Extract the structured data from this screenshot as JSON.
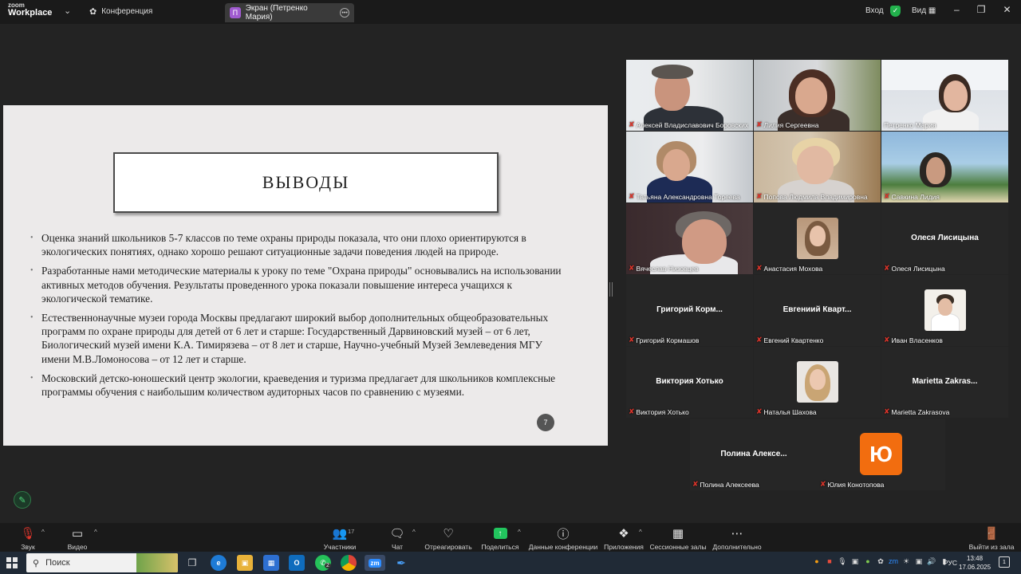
{
  "titlebar": {
    "logo_line1": "zoom",
    "logo_line2": "Workplace",
    "conference_label": "Конференция",
    "screen_tab_badge": "П",
    "screen_tab_label": "Экран (Петренко Мария)",
    "signin_label": "Вход",
    "view_label": "Вид",
    "shield_color": "#22b14c"
  },
  "slide": {
    "title": "ВЫВОДЫ",
    "bullets": [
      "Оценка знаний школьников 5-7 классов по теме охраны природы показала, что они плохо ориентируются в экологических понятиях, однако хорошо решают ситуационные задачи поведения людей на природе.",
      "Разработанные нами методические материалы к уроку по теме \"Охрана природы\" основывались на использовании активных методов обучения. Результаты проведенного урока показали повышение интереса учащихся к экологической тематике.",
      "Естественнонаучные музеи города Москвы предлагают широкий выбор дополнительных общеобразовательных программ по охране природы для детей от 6 лет и старше: Государственный Дарвиновский музей – от 6 лет, Биологический музей имени К.А. Тимирязева – от 8 лет и старше, Научно-учебный Музей Землеведения МГУ имени М.В.Ломоносова – от 12 лет и старше.",
      "Московский детско-юношеский центр экологии, краеведения и туризма предлагает для школьников комплексные программы обучения с наибольшим количеством аудиторных часов по сравнению с музеями."
    ],
    "page_number": "7"
  },
  "gallery": {
    "participants": [
      {
        "name": "Алексей Владиславович Боровских"
      },
      {
        "name": "Лилия Сергеевна"
      },
      {
        "name": "Петренко Мария"
      },
      {
        "name": "Татьяна Александровна Тореева"
      },
      {
        "name": "Попова Людмила Владимировна"
      },
      {
        "name": "Савкина Лидия"
      },
      {
        "name": "Вячеслав Низовцев"
      },
      {
        "name": "Анастасия Мохова"
      },
      {
        "name": "Олеся Лисицына",
        "display": "Олеся Лисицына"
      },
      {
        "name": "Григорий Кормашов",
        "display": "Григорий Корм..."
      },
      {
        "name": "Евгений Квартенко",
        "display": "Евгениий Кварт..."
      },
      {
        "name": "Иван Власенков"
      },
      {
        "name": "Виктория Хотько",
        "display": "Виктория Хотько"
      },
      {
        "name": "Наталья Шахова"
      },
      {
        "name": "Marietta Zakrasova",
        "display": "Marietta Zakras..."
      },
      {
        "name": "Полина Алексеева",
        "display": "Полина Алексе..."
      },
      {
        "name": "Юлия Конотопова",
        "letter": "Ю"
      }
    ],
    "active_color": "#3fdc5f",
    "avatar_letter_color": "#f26d0f"
  },
  "toolbar": {
    "audio_label": "Звук",
    "video_label": "Видео",
    "participants_label": "Участники",
    "participants_count": "17",
    "chat_label": "Чат",
    "react_label": "Отреагировать",
    "share_label": "Поделиться",
    "share_color": "#22c55e",
    "meeting_info_label": "Данные конференции",
    "apps_label": "Приложения",
    "breakout_label": "Сессионные залы",
    "more_label": "Дополнительно",
    "leave_label": "Выйти из зала"
  },
  "taskbar": {
    "search_placeholder": "Поиск",
    "whatsapp_badge": "2",
    "language": "РУС",
    "time": "13:48",
    "date": "17.06.2025",
    "notif_count": "1"
  }
}
